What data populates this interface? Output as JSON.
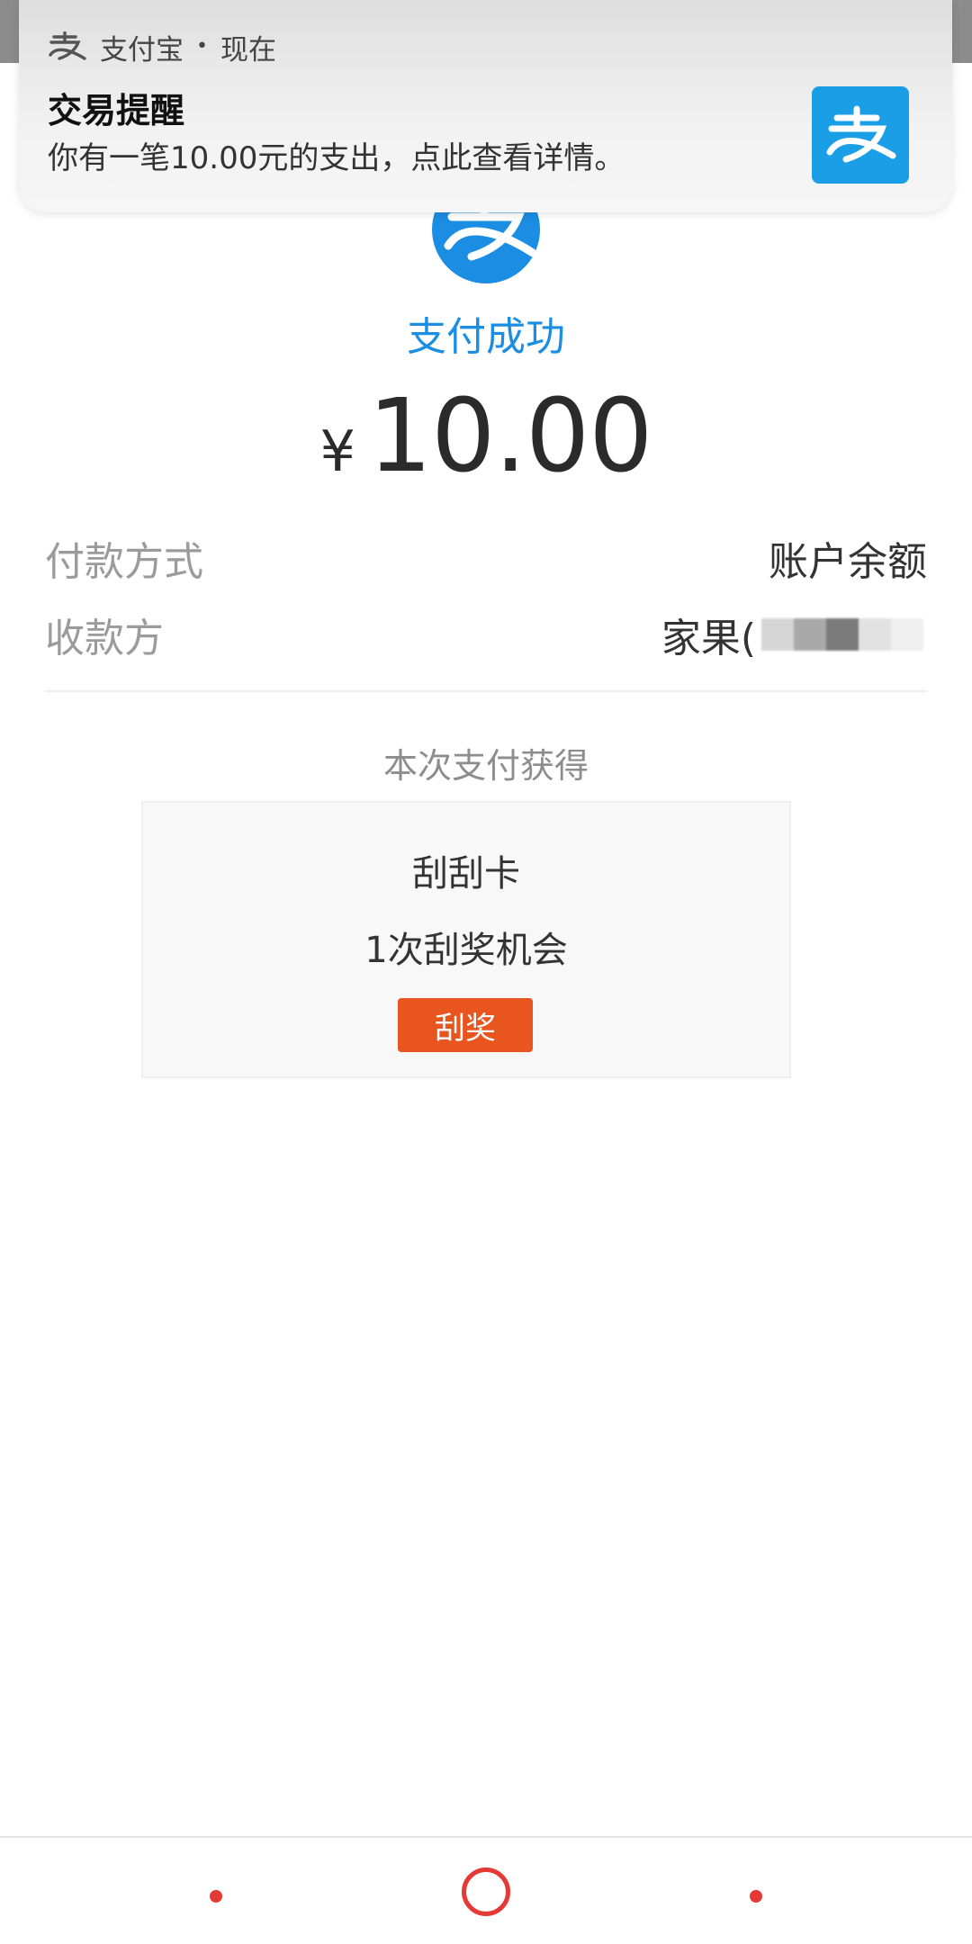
{
  "notification": {
    "app_name": "支付宝",
    "time": "现在",
    "title": "交易提醒",
    "body": "你有一笔10.00元的支出，点此查看详情。",
    "icon": "alipay-icon"
  },
  "payment": {
    "status": "支付成功",
    "currency_symbol": "¥",
    "amount": "10.00",
    "method_label": "付款方式",
    "method_value": "账户余额",
    "payee_label": "收款方",
    "payee_value": "家果("
  },
  "reward": {
    "section_title": "本次支付获得",
    "name": "刮刮卡",
    "description": "1次刮奖机会",
    "button_label": "刮奖"
  },
  "colors": {
    "alipay_blue": "#1b8de3",
    "button_orange": "#e8551f",
    "nav_red": "#e53935"
  }
}
